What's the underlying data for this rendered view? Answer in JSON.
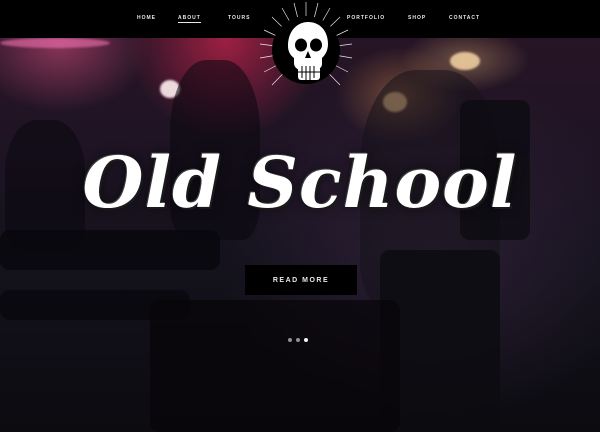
{
  "nav": {
    "items": [
      {
        "label": "Home"
      },
      {
        "label": "About"
      },
      {
        "label": "Tours"
      },
      {
        "label": "Portfolio"
      },
      {
        "label": "Shop"
      },
      {
        "label": "Contact"
      }
    ],
    "active_index": 1
  },
  "hero": {
    "title": "Old School",
    "button_label": "Read More"
  },
  "slider": {
    "dot_count": 3,
    "active_index": 2
  },
  "colors": {
    "bar_background": "#000000",
    "nav_text": "#e8e8e8",
    "title_text": "#ffffff",
    "accent_pink": "#ff2a5a"
  },
  "icons": {
    "logo": "skull-icon"
  }
}
